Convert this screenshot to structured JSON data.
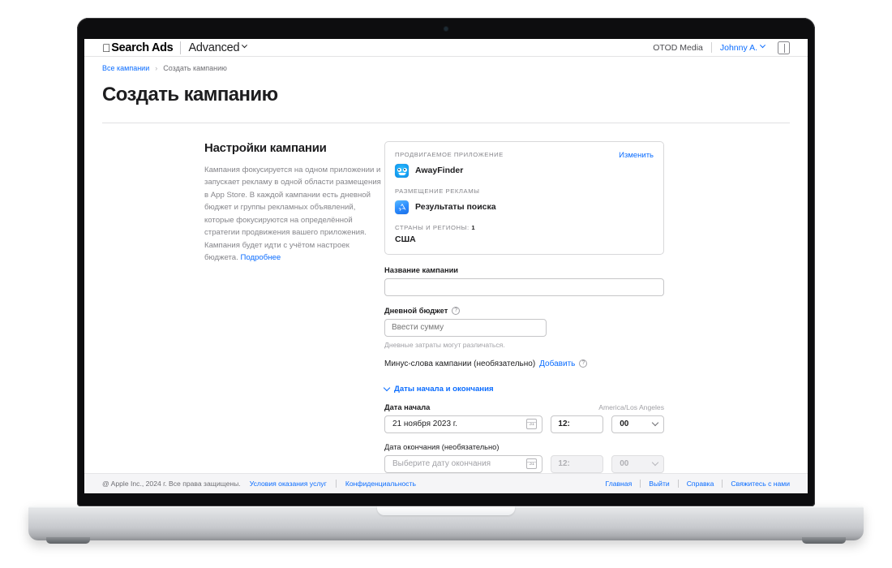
{
  "header": {
    "apple_glyph": "",
    "brand": "Search Ads",
    "tier": "Advanced",
    "tier_chevron_icon": "chevron-down-icon",
    "account": "OTOD Media",
    "user": "Johnny A.",
    "user_chevron_icon": "chevron-down-icon",
    "panel_icon": "sidebar-panel-icon"
  },
  "breadcrumb": {
    "root": "Все кампании",
    "separator": "›",
    "current": "Создать кампанию"
  },
  "page": {
    "title": "Создать кампанию"
  },
  "left_column": {
    "heading": "Настройки кампании",
    "body": "Кампания фокусируется на одном приложении и запускает рекламу в одной области размещения в App Store. В каждой кампании есть дневной бюджет и группы рекламных объявлений, которые фокусируются на определённой стратегии продвижения вашего приложения. Кампания будет идти с учётом настроек бюджета. ",
    "more_link": "Подробнее"
  },
  "summary_card": {
    "edit_link": "Изменить",
    "app_eyebrow": "ПРОДВИГАЕМОЕ ПРИЛОЖЕНИЕ",
    "app_name": "AwayFinder",
    "app_icon": "awayfinder-app-icon",
    "placement_eyebrow": "РАЗМЕЩЕНИЕ РЕКЛАМЫ",
    "placement_name": "Результаты поиска",
    "placement_icon": "app-store-icon",
    "countries_eyebrow": "СТРАНЫ И РЕГИОНЫ:",
    "countries_count": "1",
    "countries_value": "США"
  },
  "form": {
    "campaign_name_label": "Название кампании",
    "campaign_name_value": "",
    "campaign_name_placeholder": "",
    "daily_budget_label": "Дневной бюджет",
    "daily_budget_help_icon": "question-circle-icon",
    "daily_budget_placeholder": "Ввести сумму",
    "daily_budget_value": "",
    "daily_budget_hint": "Дневные затраты могут различаться.",
    "negative_keywords_label": "Минус-слова кампании (необязательно)",
    "negative_keywords_add": "Добавить",
    "negative_keywords_help_icon": "question-circle-icon",
    "dates_disclosure": "Даты начала и окончания",
    "dates_disclosure_icon": "chevron-down-icon",
    "timezone": "America/Los Angeles",
    "start_date_label": "Дата начала",
    "start_date_value": "21 ноября 2023 г.",
    "start_calendar_icon": "calendar-icon",
    "start_calendar_day": "31",
    "start_hour": "12:",
    "start_minute": "00",
    "end_date_label": "Дата окончания (необязательно)",
    "end_date_placeholder": "Выберите дату окончания",
    "end_calendar_icon": "calendar-icon",
    "end_calendar_day": "31",
    "end_hour": "12:",
    "end_minute": "00"
  },
  "footer": {
    "copyright": "@ Apple Inc., 2024 г. Все права защищены.",
    "terms": "Условия оказания услуг",
    "privacy": "Конфиденциальность",
    "home": "Главная",
    "signout": "Выйти",
    "help": "Справка",
    "contact": "Свяжитесь с нами"
  },
  "colors": {
    "accent": "#0a6cff",
    "text": "#1d1d1f",
    "muted": "#86868b",
    "footer_bg": "#f5f5f7"
  }
}
